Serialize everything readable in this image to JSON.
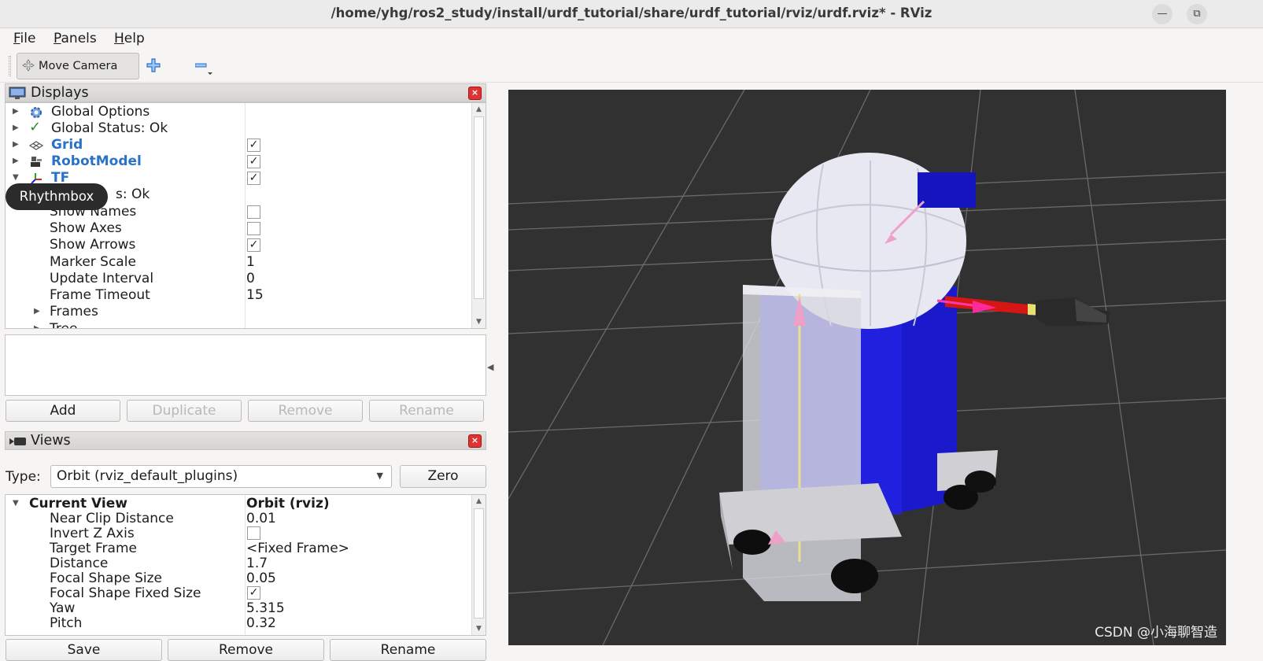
{
  "window": {
    "title": "/home/yhg/ros2_study/install/urdf_tutorial/share/urdf_tutorial/rviz/urdf.rviz* - RViz",
    "minimize_glyph": "—",
    "maximize_glyph": "⧉"
  },
  "menu": [
    {
      "accel": "F",
      "rest": "ile"
    },
    {
      "accel": "P",
      "rest": "anels"
    },
    {
      "accel": "H",
      "rest": "elp"
    }
  ],
  "toolbar": {
    "move_camera": "Move Camera"
  },
  "displays": {
    "title": "Displays",
    "close_glyph": "×",
    "rows": [
      {
        "label": "Global Options"
      },
      {
        "label": "Global Status: Ok",
        "check_glyph": "✓"
      },
      {
        "label": "Grid",
        "value": "✓"
      },
      {
        "label": "RobotModel",
        "value": "✓"
      },
      {
        "label": "TF",
        "value": "✓"
      },
      {
        "label": "s: Ok"
      },
      {
        "label": "Show Names",
        "value": ""
      },
      {
        "label": "Show Axes",
        "value": ""
      },
      {
        "label": "Show Arrows",
        "value": "✓"
      },
      {
        "label": "Marker Scale",
        "value": "1"
      },
      {
        "label": "Update Interval",
        "value": "0"
      },
      {
        "label": "Frame Timeout",
        "value": "15"
      },
      {
        "label": "Frames"
      },
      {
        "label": "Tree"
      }
    ],
    "buttons": {
      "add": "Add",
      "duplicate": "Duplicate",
      "remove": "Remove",
      "rename": "Rename"
    }
  },
  "tooltip": "Rhythmbox",
  "views": {
    "title": "Views",
    "close_glyph": "×",
    "type_label": "Type:",
    "type_value": "Orbit (rviz_default_plugins)",
    "zero": "Zero",
    "rows": [
      {
        "label": "Current View",
        "value": "Orbit (rviz)"
      },
      {
        "label": "Near Clip Distance",
        "value": "0.01"
      },
      {
        "label": "Invert Z Axis",
        "value": ""
      },
      {
        "label": "Target Frame",
        "value": "<Fixed Frame>"
      },
      {
        "label": "Distance",
        "value": "1.7"
      },
      {
        "label": "Focal Shape Size",
        "value": "0.05"
      },
      {
        "label": "Focal Shape Fixed Size",
        "value": "✓"
      },
      {
        "label": "Yaw",
        "value": "5.315"
      },
      {
        "label": "Pitch",
        "value": "0.32"
      }
    ],
    "buttons": {
      "save": "Save",
      "remove": "Remove",
      "rename": "Rename"
    }
  },
  "watermark": "CSDN @小海聊智造",
  "colors": {
    "accent_blue": "#2a72c8",
    "viewport_bg": "#313131",
    "robot_body": "#1a1acc"
  }
}
